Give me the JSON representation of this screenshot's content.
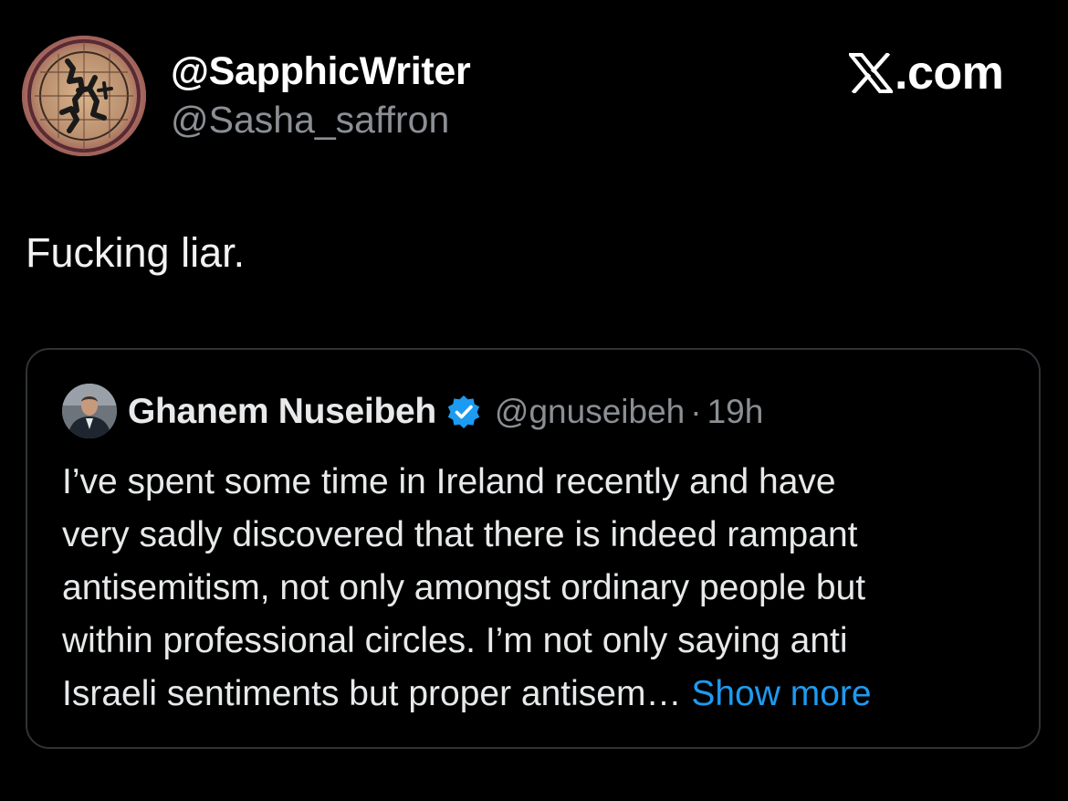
{
  "author": {
    "display_name": "@SapphicWriter",
    "handle": "@Sasha_saffron"
  },
  "brand": {
    "text": ".com"
  },
  "tweet": {
    "text": "Fucking liar."
  },
  "quoted_tweet": {
    "name": "Ghanem Nuseibeh",
    "handle": "@gnuseibeh",
    "separator": "·",
    "time": "19h",
    "lines": [
      "I’ve spent some time in Ireland recently and have",
      "very sadly discovered that there is indeed rampant",
      "antisemitism, not only amongst ordinary people but",
      "within professional circles. I’m not only saying anti",
      "Israeli sentiments but proper antisem… "
    ],
    "show_more": "Show more"
  },
  "colors": {
    "background": "#000000",
    "text": "#e7e9ea",
    "muted": "#8b8f94",
    "link": "#1d9bf0",
    "border": "#2f3336"
  },
  "icons": {
    "brand": "x-logo-icon",
    "verified": "verified-badge-icon"
  }
}
